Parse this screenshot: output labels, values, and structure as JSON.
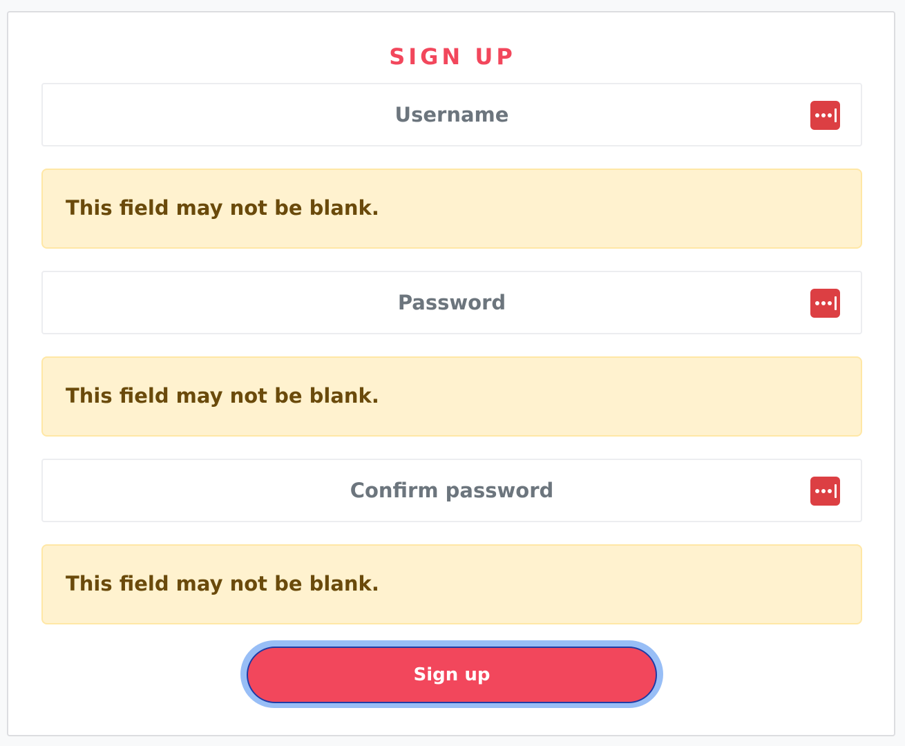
{
  "form": {
    "title": "SIGN UP",
    "username": {
      "placeholder": "Username",
      "value": ""
    },
    "password": {
      "placeholder": "Password",
      "value": ""
    },
    "confirm_password": {
      "placeholder": "Confirm password",
      "value": ""
    },
    "errors": {
      "username": "This field may not be blank.",
      "password": "This field may not be blank.",
      "confirm_password": "This field may not be blank."
    },
    "submit_label": "Sign up"
  },
  "icons": {
    "field_icon": "password-manager-icon"
  },
  "colors": {
    "accent": "#f2475c",
    "icon_red": "#dc3f43",
    "alert_bg": "#fff2cf",
    "alert_text": "#6a4a0b",
    "field_text": "#6c757d",
    "focus_ring": "#98bef6"
  }
}
